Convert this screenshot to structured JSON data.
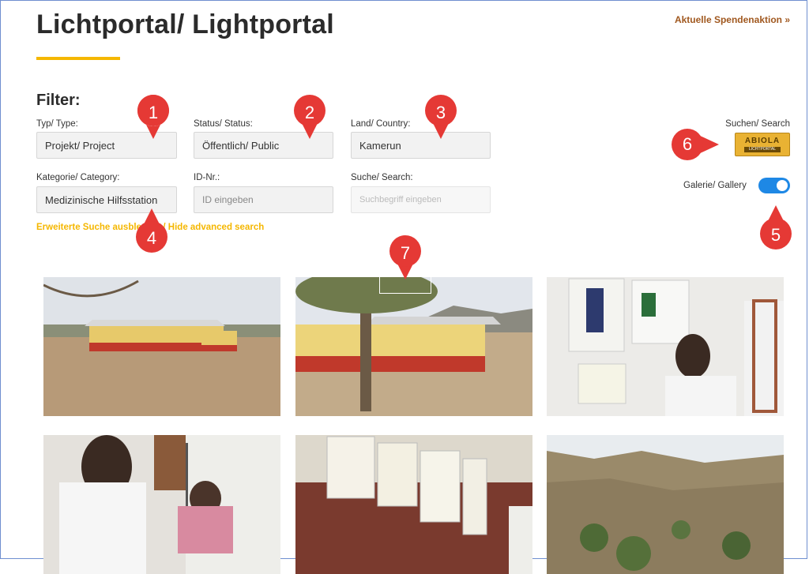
{
  "header": {
    "title": "Lichtportal/ Lightportal",
    "donation_link": "Aktuelle Spendenaktion »"
  },
  "filter": {
    "heading": "Filter:",
    "type": {
      "label": "Typ/ Type:",
      "value": "Projekt/ Project"
    },
    "status": {
      "label": "Status/ Status:",
      "value": "Öffentlich/ Public"
    },
    "country": {
      "label": "Land/ Country:",
      "value": "Kamerun"
    },
    "category": {
      "label": "Kategorie/ Category:",
      "value": "Medizinische Hilfsstation"
    },
    "id": {
      "label": "ID-Nr.:",
      "placeholder": "ID eingeben"
    },
    "search": {
      "label": "Suche/ Search:",
      "placeholder": "Suchbegriff eingeben"
    },
    "advanced_link": "Erweiterte Suche ausblenden/ Hide advanced search"
  },
  "search_button": {
    "label": "Suchen/ Search",
    "logo_text": "ABIOLA",
    "logo_sub": "LICHTPORTAL"
  },
  "gallery": {
    "label": "Galerie/ Gallery",
    "enabled": true
  },
  "annotations": [
    "1",
    "2",
    "3",
    "4",
    "5",
    "6",
    "7"
  ],
  "colors": {
    "accent": "#f5b700",
    "link": "#a0581f",
    "toggle": "#1e88e5",
    "marker": "#e53935"
  }
}
